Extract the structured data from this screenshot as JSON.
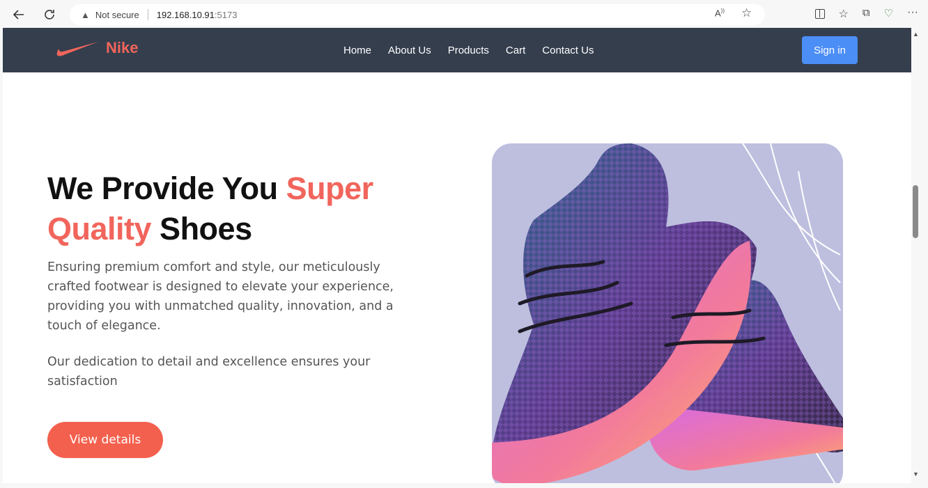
{
  "browser": {
    "security_label": "Not secure",
    "url_host": "192.168.10.91",
    "url_port": ":5173"
  },
  "navbar": {
    "brand": "Nike",
    "links": [
      "Home",
      "About Us",
      "Products",
      "Cart",
      "Contact Us"
    ],
    "signin_label": "Sign in"
  },
  "hero": {
    "title_part1": "We Provide You ",
    "title_accent": "Super Quality",
    "title_part2": " Shoes",
    "paragraph1": "Ensuring premium comfort and style, our meticulously crafted footwear is designed to elevate your experience, providing you with unmatched quality, innovation, and a touch of elegance.",
    "paragraph2": "Our dedication to detail and excellence ensures your satisfaction",
    "cta_label": "View details"
  },
  "colors": {
    "navbar_bg": "#343e4d",
    "accent": "#f1655c",
    "signin_bg": "#4b8ef5",
    "image_bg": "#bebfdf"
  }
}
